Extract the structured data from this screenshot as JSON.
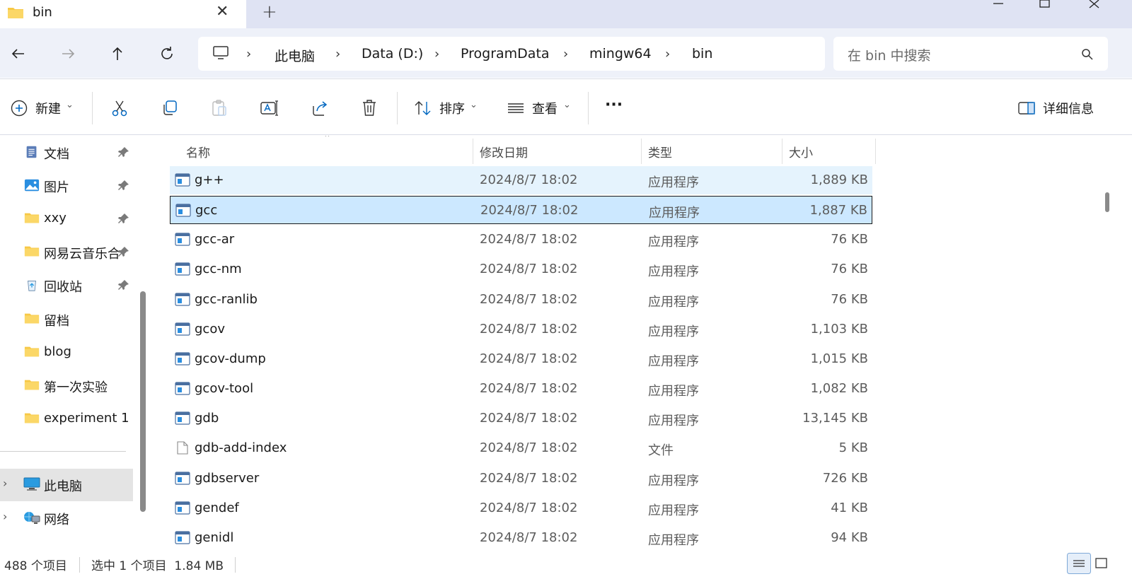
{
  "window": {
    "tab_title": "bin",
    "new_tab": "+",
    "controls": [
      "minimize-icon",
      "maximize-icon",
      "close-icon"
    ]
  },
  "address": {
    "crumbs": [
      "此电脑",
      "Data (D:)",
      "ProgramData",
      "mingw64",
      "bin"
    ],
    "search_placeholder": "在 bin 中搜索"
  },
  "toolbar": {
    "new_label": "新建",
    "sort_label": "排序",
    "view_label": "查看",
    "more_label": "···",
    "details_label": "详细信息",
    "icons": [
      "cut-icon",
      "copy-icon",
      "paste-icon",
      "rename-icon",
      "share-icon",
      "delete-icon"
    ]
  },
  "sidebar": {
    "items": [
      {
        "label": "文档",
        "icon": "document-icon",
        "pinned": true
      },
      {
        "label": "图片",
        "icon": "picture-icon",
        "pinned": true
      },
      {
        "label": "xxy",
        "icon": "folder-icon",
        "pinned": true
      },
      {
        "label": "网易云音乐合",
        "icon": "folder-icon",
        "pinned": true
      },
      {
        "label": "回收站",
        "icon": "recycle-bin-icon",
        "pinned": true
      },
      {
        "label": "留档",
        "icon": "folder-icon",
        "pinned": false
      },
      {
        "label": "blog",
        "icon": "folder-icon",
        "pinned": false
      },
      {
        "label": "第一次实验",
        "icon": "folder-icon",
        "pinned": false
      },
      {
        "label": "experiment 1",
        "icon": "folder-icon",
        "pinned": false
      }
    ],
    "this_pc": "此电脑",
    "network": "网络"
  },
  "columns": {
    "name": "名称",
    "date": "修改日期",
    "type": "类型",
    "size": "大小"
  },
  "files": [
    {
      "name": "g++",
      "date": "2024/8/7 18:02",
      "type": "应用程序",
      "size": "1,889 KB",
      "kind": "app",
      "state": "hover"
    },
    {
      "name": "gcc",
      "date": "2024/8/7 18:02",
      "type": "应用程序",
      "size": "1,887 KB",
      "kind": "app",
      "state": "selected"
    },
    {
      "name": "gcc-ar",
      "date": "2024/8/7 18:02",
      "type": "应用程序",
      "size": "76 KB",
      "kind": "app",
      "state": ""
    },
    {
      "name": "gcc-nm",
      "date": "2024/8/7 18:02",
      "type": "应用程序",
      "size": "76 KB",
      "kind": "app",
      "state": ""
    },
    {
      "name": "gcc-ranlib",
      "date": "2024/8/7 18:02",
      "type": "应用程序",
      "size": "76 KB",
      "kind": "app",
      "state": ""
    },
    {
      "name": "gcov",
      "date": "2024/8/7 18:02",
      "type": "应用程序",
      "size": "1,103 KB",
      "kind": "app",
      "state": ""
    },
    {
      "name": "gcov-dump",
      "date": "2024/8/7 18:02",
      "type": "应用程序",
      "size": "1,015 KB",
      "kind": "app",
      "state": ""
    },
    {
      "name": "gcov-tool",
      "date": "2024/8/7 18:02",
      "type": "应用程序",
      "size": "1,082 KB",
      "kind": "app",
      "state": ""
    },
    {
      "name": "gdb",
      "date": "2024/8/7 18:02",
      "type": "应用程序",
      "size": "13,145 KB",
      "kind": "app",
      "state": ""
    },
    {
      "name": "gdb-add-index",
      "date": "2024/8/7 18:02",
      "type": "文件",
      "size": "5 KB",
      "kind": "file",
      "state": ""
    },
    {
      "name": "gdbserver",
      "date": "2024/8/7 18:02",
      "type": "应用程序",
      "size": "726 KB",
      "kind": "app",
      "state": ""
    },
    {
      "name": "gendef",
      "date": "2024/8/7 18:02",
      "type": "应用程序",
      "size": "41 KB",
      "kind": "app",
      "state": ""
    },
    {
      "name": "genidl",
      "date": "2024/8/7 18:02",
      "type": "应用程序",
      "size": "94 KB",
      "kind": "app",
      "state": ""
    }
  ],
  "status": {
    "count": "488 个项目",
    "selection": "选中 1 个项目  1.84 MB"
  },
  "colors": {
    "accent": "#0067c0",
    "selected_row": "#cce8ff",
    "hover_row": "#e5f3fd",
    "folder": "#f7c846",
    "titlebar": "#dfe3f3",
    "addressbar": "#eef1f9"
  }
}
